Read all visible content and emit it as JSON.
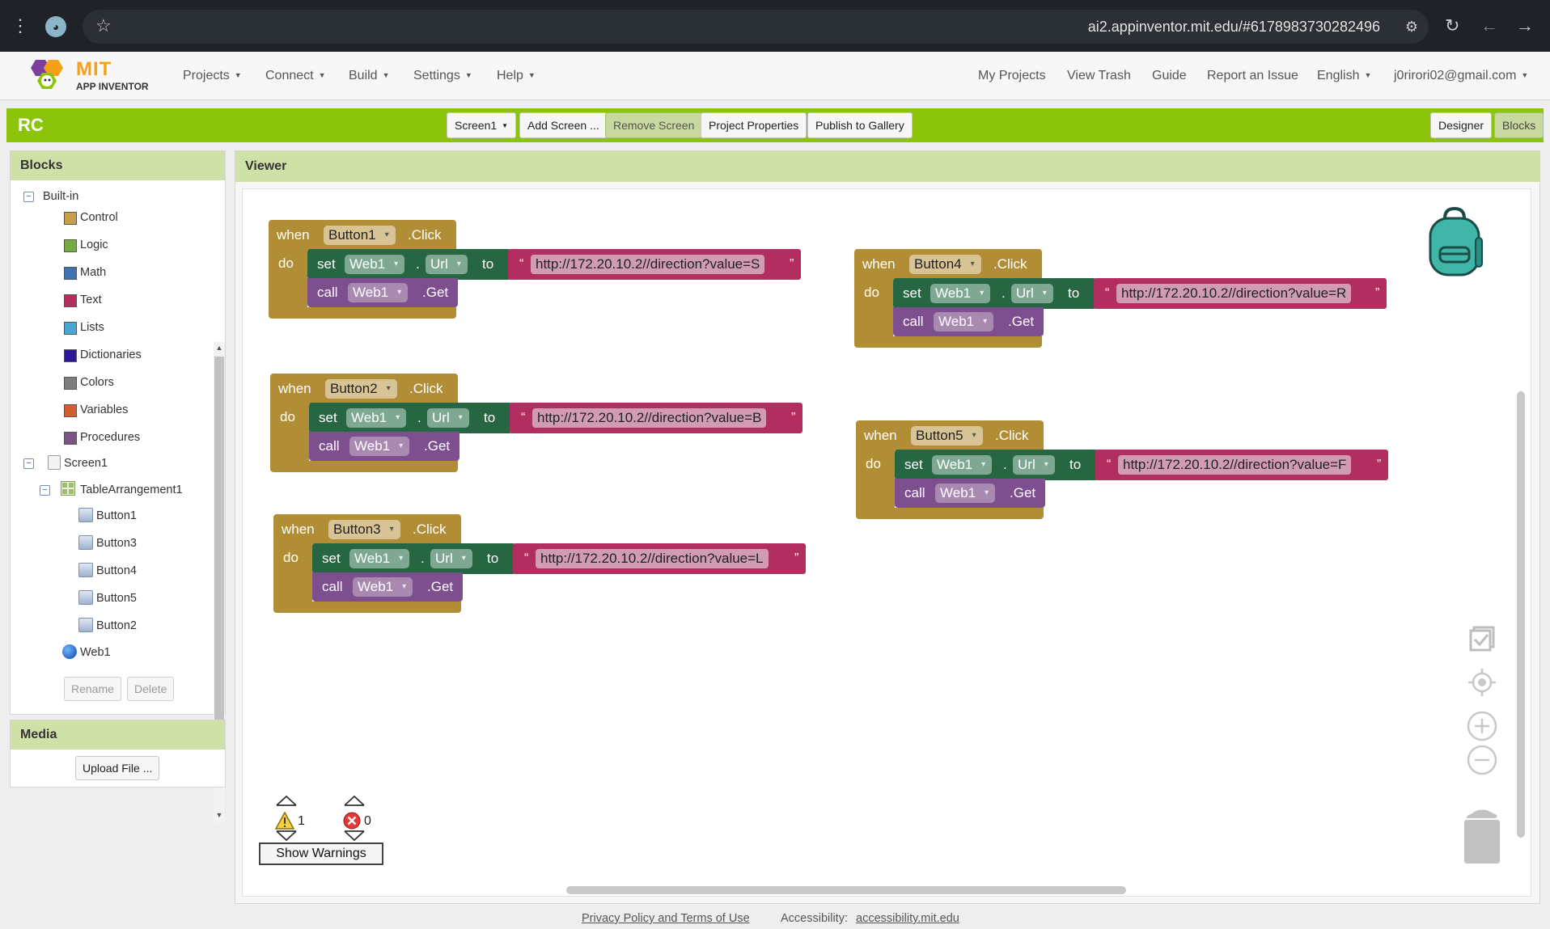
{
  "browser": {
    "url": "ai2.appinventor.mit.edu/#6178983730282496"
  },
  "nav": {
    "logo_mit": "MIT",
    "logo_sub": "APP INVENTOR",
    "left": [
      "Projects",
      "Connect",
      "Build",
      "Settings",
      "Help"
    ],
    "right": {
      "my_projects": "My Projects",
      "view_trash": "View Trash",
      "guide": "Guide",
      "report": "Report an Issue",
      "language": "English",
      "account": "j0rirori02@gmail.com"
    }
  },
  "toolbar": {
    "project_name": "RC",
    "screen": "Screen1",
    "add_screen": "Add Screen ...",
    "remove_screen": "Remove Screen",
    "project_properties": "Project Properties",
    "publish": "Publish to Gallery",
    "designer": "Designer",
    "blocks": "Blocks"
  },
  "blocks_panel": {
    "title": "Blocks",
    "builtin_label": "Built-in",
    "builtin": [
      {
        "label": "Control",
        "color": "#c8a04c"
      },
      {
        "label": "Logic",
        "color": "#77ab41"
      },
      {
        "label": "Math",
        "color": "#3f71b5"
      },
      {
        "label": "Text",
        "color": "#b32d5e"
      },
      {
        "label": "Lists",
        "color": "#49a6d4"
      },
      {
        "label": "Dictionaries",
        "color": "#2d1799"
      },
      {
        "label": "Colors",
        "color": "#7d7d7d"
      },
      {
        "label": "Variables",
        "color": "#d05f2d"
      },
      {
        "label": "Procedures",
        "color": "#7c5385"
      }
    ],
    "screen": "Screen1",
    "arrangement": "TableArrangement1",
    "components": [
      "Button1",
      "Button3",
      "Button4",
      "Button5",
      "Button2"
    ],
    "web": "Web1",
    "rename": "Rename",
    "delete": "Delete"
  },
  "media_panel": {
    "title": "Media",
    "upload": "Upload File ..."
  },
  "viewer": {
    "title": "Viewer",
    "kw": {
      "when": "when",
      "click": ".Click",
      "do": "do",
      "set": "set",
      "dot": ".",
      "to": "to",
      "call": "call",
      "get": ".Get",
      "quote_open": "“",
      "quote_close": "”"
    },
    "blocks": [
      {
        "button": "Button1",
        "component": "Web1",
        "property": "Url",
        "url": "http://172.20.10.2//direction?value=S"
      },
      {
        "button": "Button2",
        "component": "Web1",
        "property": "Url",
        "url": "http://172.20.10.2//direction?value=B"
      },
      {
        "button": "Button3",
        "component": "Web1",
        "property": "Url",
        "url": "http://172.20.10.2//direction?value=L"
      },
      {
        "button": "Button4",
        "component": "Web1",
        "property": "Url",
        "url": "http://172.20.10.2//direction?value=R"
      },
      {
        "button": "Button5",
        "component": "Web1",
        "property": "Url",
        "url": "http://172.20.10.2//direction?value=F"
      }
    ],
    "warnings_count": "1",
    "errors_count": "0",
    "show_warnings": "Show Warnings"
  },
  "footer": {
    "privacy": "Privacy Policy and Terms of Use",
    "accessibility_label": "Accessibility:",
    "accessibility_link": "accessibility.mit.edu"
  }
}
